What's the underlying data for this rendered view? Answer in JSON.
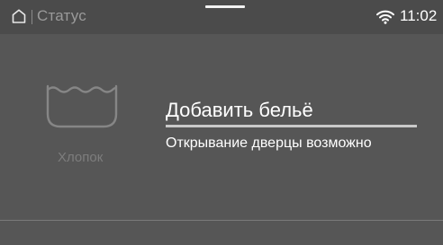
{
  "status_bar": {
    "home_icon": "home-icon",
    "title": "Статус",
    "wifi_icon": "wifi-icon",
    "time": "11:02"
  },
  "program": {
    "icon": "cotton-tub-icon",
    "label": "Хлопок"
  },
  "action": {
    "title": "Добавить бельё",
    "subtitle": "Открывание дверцы возможно"
  },
  "colors": {
    "background": "#565656",
    "status_bar": "#4b4b4b",
    "text_primary": "#ffffff",
    "text_muted": "#9a9a9a",
    "accent_line": "#c9c9c9"
  }
}
